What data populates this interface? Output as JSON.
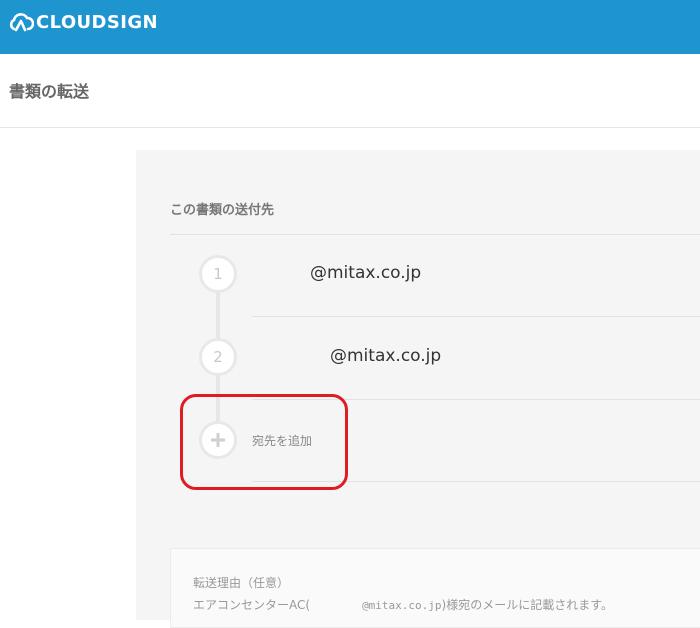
{
  "header": {
    "logo_text": "CLOUDSIGN",
    "brand_color": "#1e95cf"
  },
  "page": {
    "title": "書類の転送"
  },
  "recipients": {
    "section_title": "この書類の送付先",
    "items": [
      {
        "number": "1",
        "email": "@mitax.co.jp"
      },
      {
        "number": "2",
        "email": "@mitax.co.jp"
      }
    ],
    "add_label": "宛先を追加",
    "add_icon": "plus-icon"
  },
  "reason": {
    "label": "転送理由（任意）",
    "note_prefix": "エアコンセンターAC(",
    "note_email": "@mitax.co.jp",
    "note_suffix": ")様宛のメールに記載されます。"
  },
  "annotation": {
    "highlight_color": "#e01b22"
  }
}
